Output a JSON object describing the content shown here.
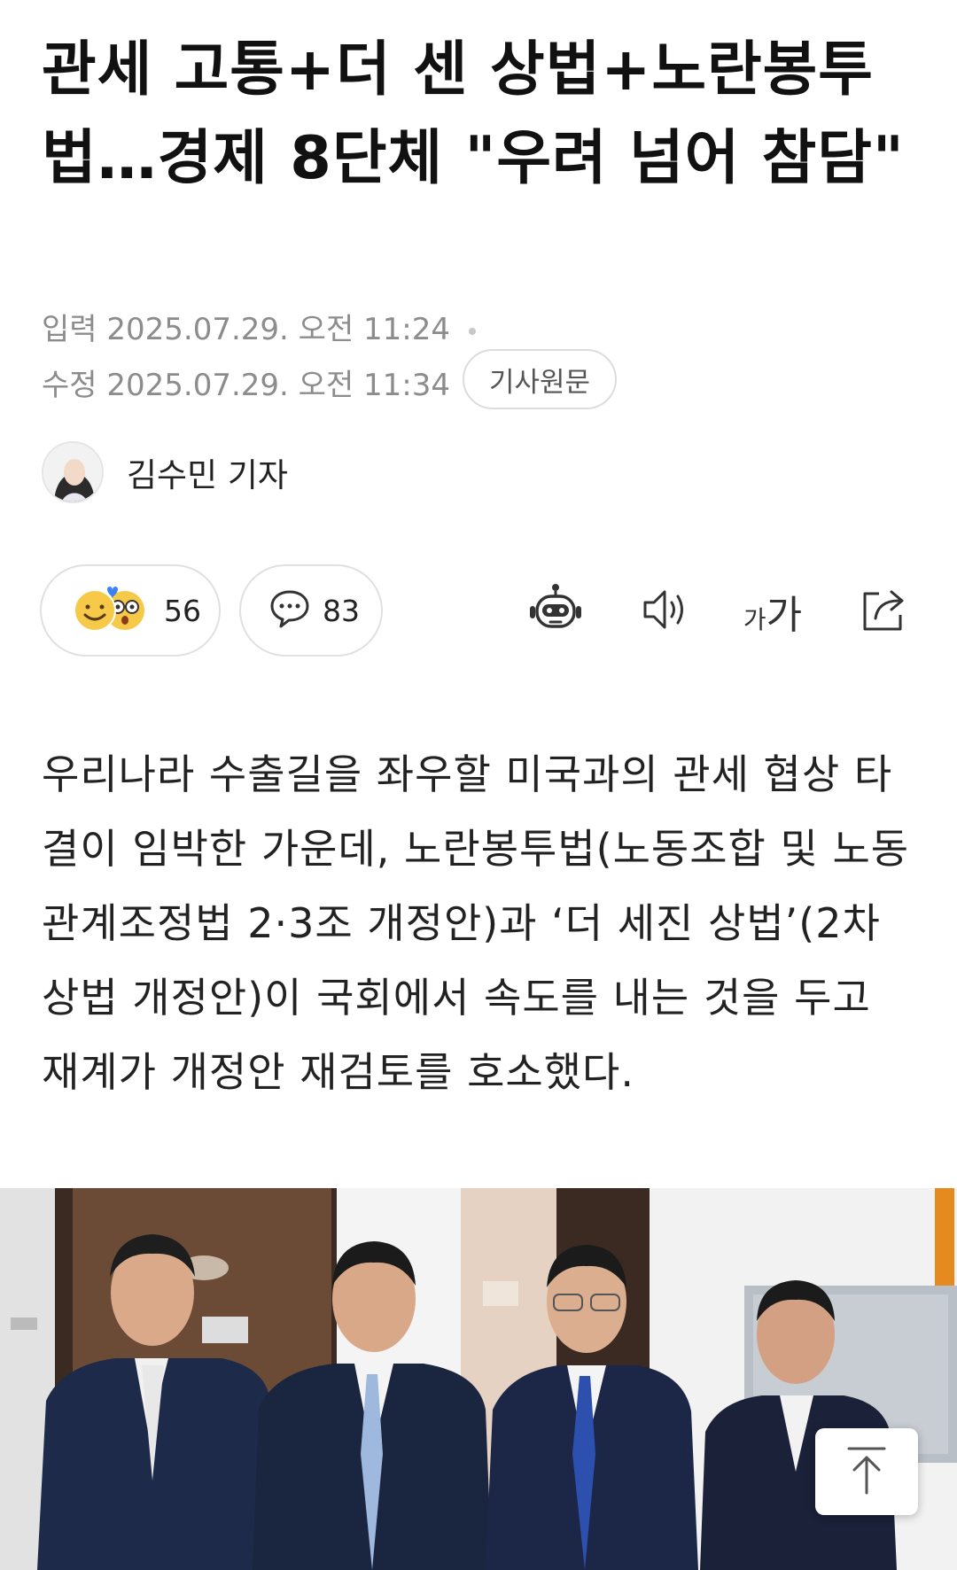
{
  "article": {
    "headline": "관세 고통+더 센 상법+노란봉투법…경제 8단체 \"우려 넘어 참담\"",
    "published_label": "입력",
    "published": "2025.07.29. 오전 11:24",
    "modified_label": "수정",
    "modified": "2025.07.29. 오전 11:34",
    "original_button": "기사원문",
    "reporter": "김수민 기자",
    "body": "우리나라 수출길을 좌우할 미국과의 관세 협상 타결이 임박한 가운데, 노란봉투법(노동조합 및 노동관계조정법 2·3조 개정안)과 ‘더 세진 상법’(2차 상법 개정안)이 국회에서 속도를 내는 것을 두고 재계가 개정안 재검토를 호소했다."
  },
  "actions": {
    "reactions_count": "56",
    "comments_count": "83",
    "font_small": "가",
    "font_large": "가"
  },
  "icons": {
    "reaction": "emoji-reaction-icon",
    "comment": "speech-bubble-icon",
    "ai_summary": "robot-icon",
    "tts": "speaker-icon",
    "font_size": "font-size-icon",
    "share": "share-icon",
    "scroll_top": "arrow-up-icon"
  },
  "colors": {
    "meta_text": "#8c8c8c",
    "emoji_yellow": "#f7c948",
    "heart_blue": "#3b82f6"
  }
}
